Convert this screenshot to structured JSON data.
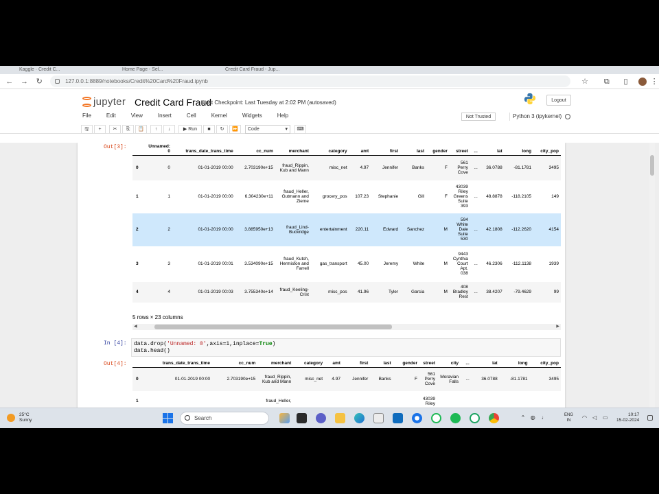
{
  "browser": {
    "tabs": [
      "Kaggle · Credit C...",
      "Home Page - Sel...",
      "Credit Card Fraud - Jup..."
    ],
    "url": "127.0.0.1:8889/notebooks/Credit%20Card%20Fraud.ipynb"
  },
  "jupyter": {
    "logo_text": "jupyter",
    "notebook_title": "Credit Card Fraud",
    "checkpoint": "Last Checkpoint: Last Tuesday at 2:02 PM  (autosaved)",
    "logout_label": "Logout",
    "menu": [
      "File",
      "Edit",
      "View",
      "Insert",
      "Cell",
      "Kernel",
      "Widgets",
      "Help"
    ],
    "trust_label": "Not Trusted",
    "kernel_label": "Python 3 (ipykernel)",
    "toolbar": {
      "save": "🖫",
      "add": "+",
      "cut": "✂",
      "copy": "⎘",
      "paste": "📋",
      "up": "↑",
      "down": "↓",
      "run": "▶ Run",
      "stop": "■",
      "restart": "↻",
      "restart_run": "⏩",
      "cell_type": "Code",
      "keyboard": "⌨"
    }
  },
  "out3": {
    "prompt": "Out[3]:",
    "columns": [
      "Unnamed: 0",
      "trans_date_trans_time",
      "cc_num",
      "merchant",
      "category",
      "amt",
      "first",
      "last",
      "gender",
      "street",
      "...",
      "lat",
      "long",
      "city_pop"
    ],
    "rows": [
      [
        "0",
        "0",
        "01-01-2019 00:00",
        "2.703190e+15",
        "fraud_Rippin, Kub and Mann",
        "misc_net",
        "4.97",
        "Jennifer",
        "Banks",
        "F",
        "561 Perry Cove",
        "...",
        "36.0788",
        "-81.1781",
        "3495"
      ],
      [
        "1",
        "1",
        "01-01-2019 00:00",
        "6.304230e+11",
        "fraud_Heller, Gutmann and Zieme",
        "grocery_pos",
        "107.23",
        "Stephanie",
        "Gill",
        "F",
        "43039 Riley Greens Suite 393",
        "...",
        "48.8878",
        "-118.2105",
        "149"
      ],
      [
        "2",
        "2",
        "01-01-2019 00:00",
        "3.885950e+13",
        "fraud_Lind-Buckridge",
        "entertainment",
        "220.11",
        "Edward",
        "Sanchez",
        "M",
        "594 White Dale Suite 530",
        "...",
        "42.1808",
        "-112.2620",
        "4154"
      ],
      [
        "3",
        "3",
        "01-01-2019 00:01",
        "3.534090e+15",
        "fraud_Kutch, Hermiston and Farrell",
        "gas_transport",
        "45.00",
        "Jeremy",
        "White",
        "M",
        "9443 Cynthia Court Apt. 038",
        "...",
        "46.2306",
        "-112.1138",
        "1939"
      ],
      [
        "4",
        "4",
        "01-01-2019 00:03",
        "3.755340e+14",
        "fraud_Keeling-Crist",
        "misc_pos",
        "41.96",
        "Tyler",
        "Garcia",
        "M",
        "408 Bradley Rest",
        "...",
        "38.4207",
        "-79.4629",
        "99"
      ]
    ],
    "shape_note": "5 rows × 23 columns"
  },
  "in4": {
    "prompt": "In [4]:",
    "code_line1_pre": "data.drop(",
    "code_line1_str": "'Unnamed: 0'",
    "code_line1_mid": ",axis=1,inplace=",
    "code_line1_kw": "True",
    "code_line1_post": ")",
    "code_line2": "data.head()"
  },
  "out4": {
    "prompt": "Out[4]:",
    "columns": [
      "trans_date_trans_time",
      "cc_num",
      "merchant",
      "category",
      "amt",
      "first",
      "last",
      "gender",
      "street",
      "city",
      "...",
      "lat",
      "long",
      "city_pop"
    ],
    "rows": [
      [
        "0",
        "01-01-2019 00:00",
        "2.703190e+15",
        "fraud_Rippin, Kub and Mann",
        "misc_net",
        "4.97",
        "Jennifer",
        "Banks",
        "F",
        "561 Perry Cove",
        "Moravian Falls",
        "...",
        "36.0788",
        "-81.1781",
        "3495"
      ],
      [
        "1",
        "",
        "",
        "fraud_Heller,",
        "",
        "",
        "",
        "",
        "",
        "43039 Riley",
        "",
        "",
        "",
        "",
        ""
      ]
    ]
  },
  "taskbar": {
    "weather_temp": "25°C",
    "weather_desc": "Sunny",
    "search_placeholder": "Search",
    "lang": "ENG",
    "lang_region": "IN",
    "time": "10:17",
    "date": "15-02-2024"
  }
}
